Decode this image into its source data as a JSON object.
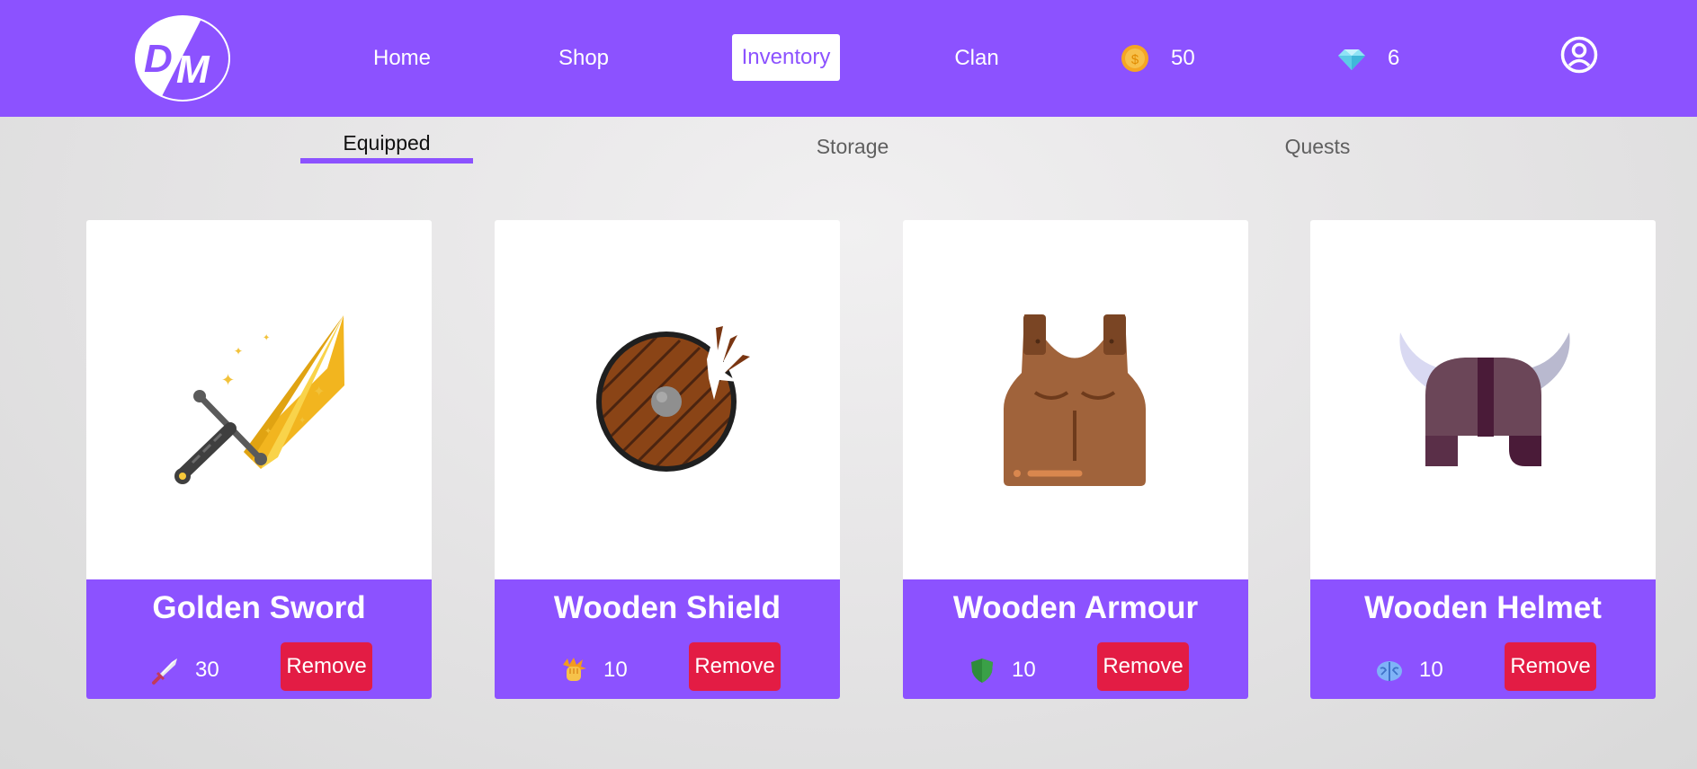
{
  "app": {
    "logo_text": "DM",
    "accent_color": "#8c52ff",
    "danger_color": "#e31c44"
  },
  "nav": {
    "home": "Home",
    "shop": "Shop",
    "inventory": "Inventory",
    "clan": "Clan",
    "active": "Inventory"
  },
  "currency": {
    "coins": {
      "icon": "coin-icon",
      "value": "50"
    },
    "gems": {
      "icon": "diamond-icon",
      "value": "6"
    }
  },
  "profile": {
    "icon": "user-circle-icon"
  },
  "tabs": {
    "equipped": "Equipped",
    "storage": "Storage",
    "quests": "Quests",
    "active": "Equipped"
  },
  "items": [
    {
      "name": "Golden Sword",
      "image": "golden-sword-icon",
      "stat_icon": "sword-icon",
      "stat_value": "30",
      "action": "Remove"
    },
    {
      "name": "Wooden Shield",
      "image": "wooden-shield-icon",
      "stat_icon": "fist-icon",
      "stat_value": "10",
      "action": "Remove"
    },
    {
      "name": "Wooden Armour",
      "image": "wooden-armour-icon",
      "stat_icon": "shield-icon",
      "stat_value": "10",
      "action": "Remove"
    },
    {
      "name": "Wooden Helmet",
      "image": "wooden-helmet-icon",
      "stat_icon": "brain-icon",
      "stat_value": "10",
      "action": "Remove"
    }
  ]
}
